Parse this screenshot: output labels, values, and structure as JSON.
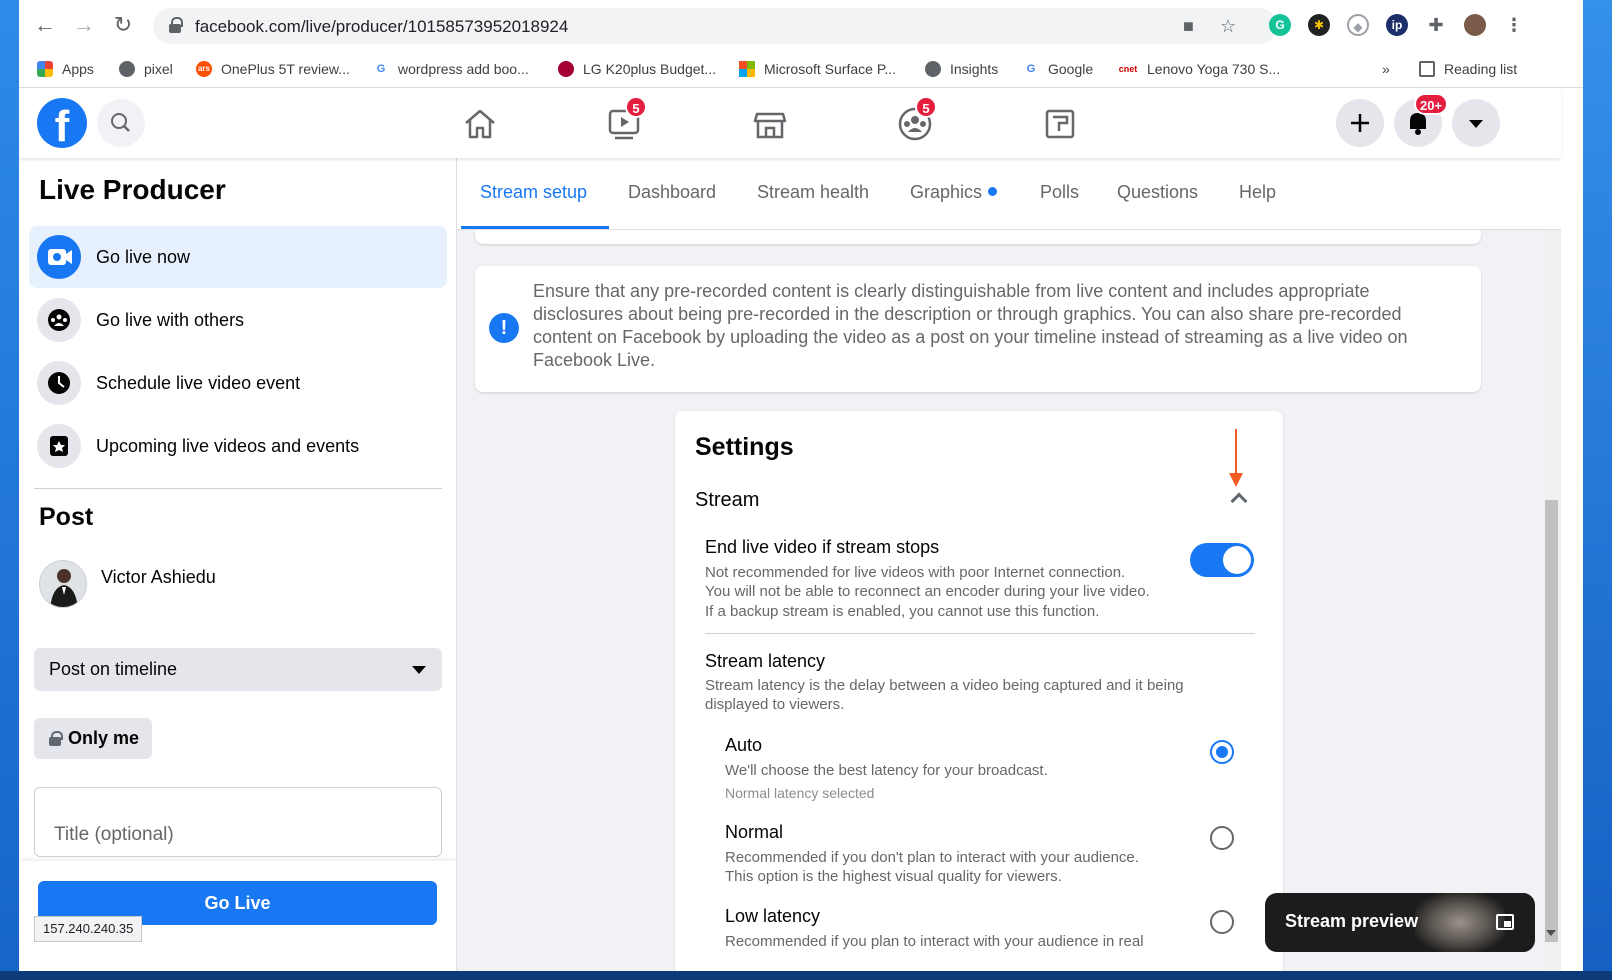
{
  "browser": {
    "url": "facebook.com/live/producer/10158573952018924",
    "bookmarks": [
      {
        "label": "Apps",
        "icon": "apps-grid-icon"
      },
      {
        "label": "pixel",
        "icon": "apple-icon"
      },
      {
        "label": "OnePlus 5T review...",
        "icon": "ars-icon"
      },
      {
        "label": "wordpress add boo...",
        "icon": "google-icon"
      },
      {
        "label": "LG K20plus Budget...",
        "icon": "lg-icon"
      },
      {
        "label": "Microsoft Surface P...",
        "icon": "microsoft-icon"
      },
      {
        "label": "Insights",
        "icon": "globe-icon"
      },
      {
        "label": "Google",
        "icon": "google-icon"
      },
      {
        "label": "Lenovo Yoga 730 S...",
        "icon": "cnet-icon"
      }
    ],
    "bookmarks_overflow": "»",
    "reading_list": "Reading list",
    "status_url": "157.240.240.35"
  },
  "fb": {
    "logo": "f",
    "watch_badge": "5",
    "groups_badge": "5",
    "notif_badge": "20+"
  },
  "sidebar": {
    "title": "Live Producer",
    "items": [
      {
        "label": "Go live now"
      },
      {
        "label": "Go live with others"
      },
      {
        "label": "Schedule live video event"
      },
      {
        "label": "Upcoming live videos and events"
      }
    ],
    "post_heading": "Post",
    "user_name": "Victor Ashiedu",
    "post_target": "Post on timeline",
    "privacy": "Only me",
    "title_placeholder": "Title (optional)",
    "go_live": "Go Live"
  },
  "tabs": [
    {
      "label": "Stream setup"
    },
    {
      "label": "Dashboard"
    },
    {
      "label": "Stream health"
    },
    {
      "label": "Graphics"
    },
    {
      "label": "Polls"
    },
    {
      "label": "Questions"
    },
    {
      "label": "Help"
    }
  ],
  "notice": "Ensure that any pre-recorded content is clearly distinguishable from live content and includes appropriate disclosures about being pre-recorded in the description or through graphics. You can also share pre-recorded content on Facebook by uploading the video as a post on your timeline instead of streaming as a live video on Facebook Live.",
  "settings": {
    "title": "Settings",
    "section": "Stream",
    "end_live": {
      "label": "End live video if stream stops",
      "desc1": "Not recommended for live videos with poor Internet connection.",
      "desc2": "You will not be able to reconnect an encoder during your live video.",
      "desc3": "If a backup stream is enabled, you cannot use this function.",
      "enabled": true
    },
    "latency": {
      "label": "Stream latency",
      "desc1": "Stream latency is the delay between a video being captured and it being",
      "desc2": "displayed to viewers.",
      "options": [
        {
          "label": "Auto",
          "desc1": "We'll choose the best latency for your broadcast.",
          "desc2": "Normal latency selected",
          "selected": true
        },
        {
          "label": "Normal",
          "desc1": "Recommended if you don't plan to interact with your audience.",
          "desc2": "This option is the highest visual quality for viewers.",
          "selected": false
        },
        {
          "label": "Low latency",
          "desc1": "Recommended if you plan to interact with your audience in real",
          "selected": false
        }
      ]
    }
  },
  "preview": {
    "label": "Stream preview"
  },
  "colors": {
    "fb_blue": "#1877f2",
    "badge_red": "#e41e3f",
    "arrow_orange": "#f25c22"
  }
}
